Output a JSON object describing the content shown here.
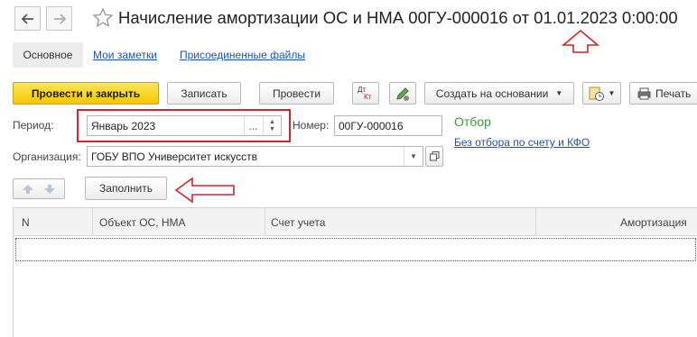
{
  "header": {
    "back_icon": "arrow-left-icon",
    "forward_icon": "arrow-right-icon",
    "favorite_icon": "star-icon",
    "title": "Начисление амортизации ОС и НМА 00ГУ-000016 от 01.01.2023 0:00:00"
  },
  "tabs": [
    {
      "label": "Основное"
    },
    {
      "label": "Мои заметки"
    },
    {
      "label": "Присоединенные файлы"
    }
  ],
  "toolbar": {
    "post_close": "Провести и закрыть",
    "save": "Записать",
    "post": "Провести",
    "dt_icon_top": "Дт",
    "dt_icon_bottom": "Кт",
    "create_based": "Создать на основании",
    "print": "Печать"
  },
  "form": {
    "period_label": "Период:",
    "period_value": "Январь 2023",
    "period_dots": "...",
    "number_label": "Номер:",
    "number_value": "00ГУ-000016",
    "filter_title": "Отбор",
    "filter_link": "Без отбора по счету и КФО",
    "org_label": "Организация:",
    "org_value": "ГОБУ ВПО Университет искусств"
  },
  "actions": {
    "fill": "Заполнить"
  },
  "table": {
    "columns": [
      "N",
      "Объект ОС, НМА",
      "Счет учета",
      "Амортизация"
    ]
  },
  "colors": {
    "accent_yellow": "#f4c800",
    "annotation_red": "#d4242b",
    "link_blue": "#1d52a8",
    "filter_green": "#3a9a3a"
  }
}
